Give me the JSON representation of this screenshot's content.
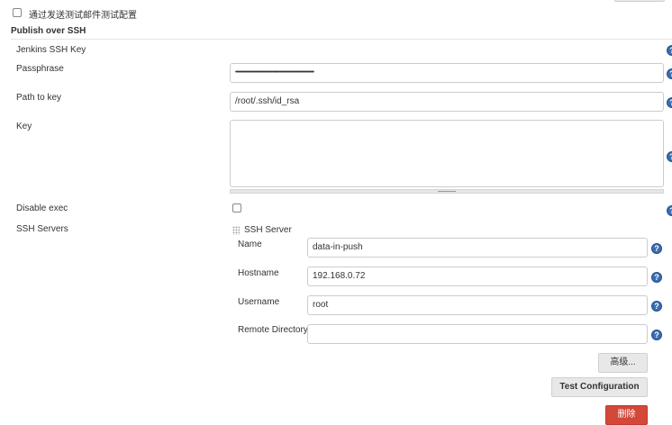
{
  "email_test": {
    "label": "通过发送测试邮件测试配置",
    "checked": false
  },
  "section": {
    "title": "Publish over SSH"
  },
  "fields": {
    "jenkins_ssh_key": "Jenkins SSH Key",
    "passphrase": {
      "label": "Passphrase",
      "value": "••••••••••••••••••••••••••••••••••••••••••••••••••••••••••••"
    },
    "path_to_key": {
      "label": "Path to key",
      "value": "/root/.ssh/id_rsa"
    },
    "key": {
      "label": "Key",
      "value": ""
    },
    "disable_exec": {
      "label": "Disable exec",
      "checked": false
    },
    "ssh_servers": "SSH Servers"
  },
  "server": {
    "header": "SSH Server",
    "name": {
      "label": "Name",
      "value": "data-in-push"
    },
    "hostname": {
      "label": "Hostname",
      "value": "192.168.0.72"
    },
    "username": {
      "label": "Username",
      "value": "root"
    },
    "remote_directory": {
      "label": "Remote Directory",
      "value": ""
    },
    "advanced_button": "高级...",
    "test_button": "Test Configuration",
    "delete_button": "删除"
  },
  "help_icon": "?"
}
